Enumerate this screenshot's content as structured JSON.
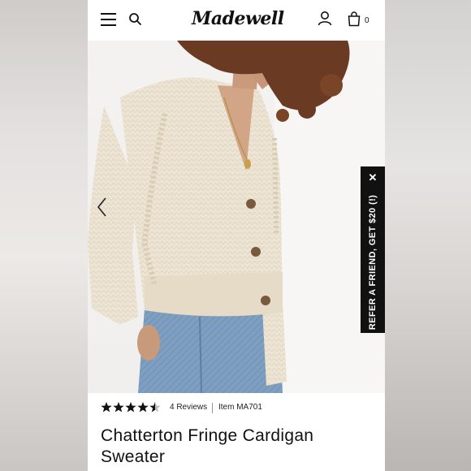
{
  "header": {
    "logo": "Madewell",
    "bag_count": "0"
  },
  "hero": {
    "refer_label": "REFER A FRIEND, GET $20 (!)",
    "refer_close": "✕"
  },
  "product": {
    "rating": 4.5,
    "rating_max": 5,
    "reviews": "4 Reviews",
    "item": "Item MA701",
    "title": "Chatterton Fringe Cardigan Sweater"
  }
}
